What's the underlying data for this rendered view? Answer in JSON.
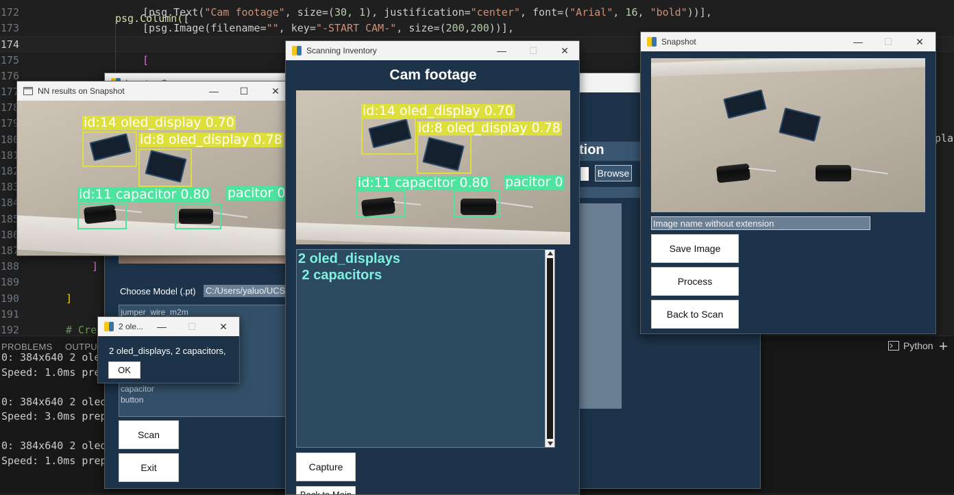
{
  "editor": {
    "lines": [
      {
        "num": "172",
        "text_parts": [
          [
            "[psg.Text(",
            ""
          ],
          [
            "\"Cam footage\"",
            "str"
          ],
          [
            ", size=(",
            ""
          ],
          [
            "30",
            "num"
          ],
          [
            ", ",
            ""
          ],
          [
            "1",
            "num"
          ],
          [
            "), justification=",
            ""
          ],
          [
            "\"center\"",
            "str"
          ],
          [
            ", font=(",
            ""
          ],
          [
            "\"Arial\"",
            "str"
          ],
          [
            ", ",
            ""
          ],
          [
            "16",
            "num"
          ],
          [
            ", ",
            ""
          ],
          [
            "\"bold\"",
            "str"
          ],
          [
            "))],",
            ""
          ]
        ]
      },
      {
        "num": "173",
        "text_parts": [
          [
            "[psg.Image(filename=",
            ""
          ],
          [
            "\"\"",
            "str"
          ],
          [
            ", key=",
            ""
          ],
          [
            "\"-START CAM-\"",
            "str"
          ],
          [
            ", size=(",
            ""
          ],
          [
            "200",
            "num"
          ],
          [
            ",",
            ""
          ],
          [
            "200",
            "num"
          ],
          [
            "))],",
            ""
          ]
        ]
      },
      {
        "num": "174",
        "text_parts": []
      },
      {
        "num": "175",
        "text_parts": [
          [
            "[",
            "br"
          ]
        ]
      },
      {
        "num": "176",
        "text_parts": []
      },
      {
        "num": "177",
        "text_parts": []
      },
      {
        "num": "178",
        "text_parts": []
      },
      {
        "num": "179",
        "text_parts": []
      },
      {
        "num": "180",
        "text_parts": []
      },
      {
        "num": "181",
        "text_parts": []
      },
      {
        "num": "182",
        "text_parts": []
      },
      {
        "num": "183",
        "text_parts": []
      },
      {
        "num": "184",
        "text_parts": []
      },
      {
        "num": "185",
        "text_parts": []
      },
      {
        "num": "186",
        "text_parts": []
      },
      {
        "num": "187",
        "text_parts": []
      },
      {
        "num": "188",
        "text_parts": [
          [
            "]",
            "br"
          ]
        ]
      },
      {
        "num": "189",
        "text_parts": []
      },
      {
        "num": "190",
        "text_parts": [
          [
            "]",
            "br2"
          ]
        ]
      },
      {
        "num": "191",
        "text_parts": []
      },
      {
        "num": "192",
        "text_parts": [
          [
            "# Cre",
            "cm"
          ]
        ]
      }
    ],
    "line171_fragment": "psg.Column([",
    "right_fragment": "play"
  },
  "panel": {
    "tabs": [
      "PROBLEMS",
      "OUTPUT"
    ],
    "terminal_lines": [
      "0: 384x640 2 ole",
      "Speed: 1.0ms prep",
      "",
      "0: 384x640 2 oled",
      "Speed: 3.0ms prep",
      "",
      "0: 384x640 2 oled",
      "Speed: 1.0ms prep"
    ],
    "python_label": "Python",
    "plus": "+"
  },
  "main_window": {
    "title_fragment": "Inventory Scan",
    "heading_fragment": "tion",
    "browse_label": "Browse",
    "choose_model_label": "Choose Model (.pt)",
    "model_path": "C:/Users/yaluo/UCS",
    "class_list": [
      "jumper_wire_m2m",
      "capacitor",
      "button"
    ],
    "scan_label": "Scan",
    "exit_label": "Exit"
  },
  "nn_window": {
    "title": "NN results on Snapshot",
    "labels": {
      "y1": "id:14 oled_display 0.70",
      "y2": "id:8 oled_display 0.78",
      "g1": "id:11 capacitor 0.80",
      "g2": "pacitor 0"
    }
  },
  "scan_window": {
    "title": "Scanning Inventory",
    "heading": "Cam footage",
    "labels": {
      "y1": "id:14 oled_display 0.70",
      "y2": "id:8 oled_display 0.78",
      "g1": "id:11 capacitor 0.80",
      "g2": "pacitor 0"
    },
    "output_line1": "2 oled_displays",
    "output_line2": " 2 capacitors",
    "capture_label": "Capture",
    "back_main_label": "Back to Main"
  },
  "snapshot_window": {
    "title": "Snapshot",
    "name_placeholder": "Image name without extension",
    "save_label": "Save Image",
    "process_label": "Process",
    "back_scan_label": "Back to Scan"
  },
  "popup": {
    "title": "2 ole...",
    "message": "2 oled_displays, 2 capacitors,",
    "ok_label": "OK"
  },
  "colors": {
    "pysimplegui_bg": "#1c3349",
    "yolo_yellow": "#dede3c",
    "yolo_green": "#4fe3a0",
    "output_text": "#7ff0e0"
  }
}
